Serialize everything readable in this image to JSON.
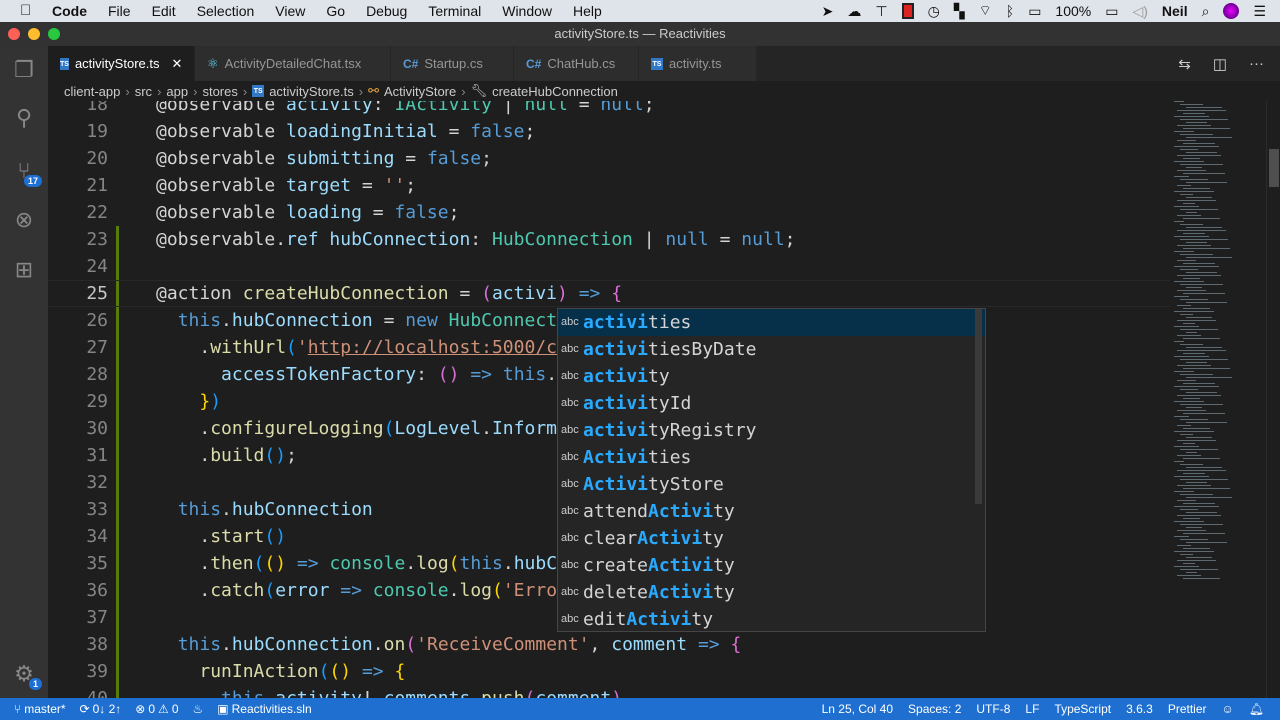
{
  "menubar": {
    "app": "Code",
    "items": [
      "File",
      "Edit",
      "Selection",
      "View",
      "Go",
      "Debug",
      "Terminal",
      "Window",
      "Help"
    ],
    "battery": "100%",
    "user": "Neil"
  },
  "window": {
    "title": "activityStore.ts — Reactivities"
  },
  "activity_bar": {
    "scm_badge": "17",
    "settings_badge": "1"
  },
  "tabs": [
    {
      "label": "activityStore.ts",
      "icon": "ts",
      "active": true
    },
    {
      "label": "ActivityDetailedChat.tsx",
      "icon": "react"
    },
    {
      "label": "Startup.cs",
      "icon": "cs"
    },
    {
      "label": "ChatHub.cs",
      "icon": "cs"
    },
    {
      "label": "activity.ts",
      "icon": "ts"
    }
  ],
  "breadcrumb": [
    "client-app",
    "src",
    "app",
    "stores",
    "activityStore.ts",
    "ActivityStore",
    "createHubConnection"
  ],
  "code_lines": [
    {
      "n": "18",
      "t": [
        [
          "@observable ",
          ""
        ],
        [
          "activity",
          "prop"
        ],
        [
          ": ",
          ""
        ],
        [
          "IActivity",
          "type"
        ],
        [
          " | ",
          ""
        ],
        [
          "null",
          "type"
        ],
        [
          " = ",
          ""
        ],
        [
          "null",
          "kw"
        ],
        [
          ";",
          ""
        ]
      ]
    },
    {
      "n": "19",
      "t": [
        [
          "@observable ",
          ""
        ],
        [
          "loadingInitial",
          "prop"
        ],
        [
          " = ",
          ""
        ],
        [
          "false",
          "kw"
        ],
        [
          ";",
          ""
        ]
      ]
    },
    {
      "n": "20",
      "t": [
        [
          "@observable ",
          ""
        ],
        [
          "submitting",
          "prop"
        ],
        [
          " = ",
          ""
        ],
        [
          "false",
          "kw"
        ],
        [
          ";",
          ""
        ]
      ]
    },
    {
      "n": "21",
      "t": [
        [
          "@observable ",
          ""
        ],
        [
          "target",
          "prop"
        ],
        [
          " = ",
          ""
        ],
        [
          "''",
          "str"
        ],
        [
          ";",
          ""
        ]
      ]
    },
    {
      "n": "22",
      "t": [
        [
          "@observable ",
          ""
        ],
        [
          "loading",
          "prop"
        ],
        [
          " = ",
          ""
        ],
        [
          "false",
          "kw"
        ],
        [
          ";",
          ""
        ]
      ]
    },
    {
      "n": "23",
      "t": [
        [
          "@observable.",
          ""
        ],
        [
          "ref ",
          "prop"
        ],
        [
          "hubConnection",
          "prop"
        ],
        [
          ": ",
          ""
        ],
        [
          "HubConnection",
          "type"
        ],
        [
          " | ",
          ""
        ],
        [
          "null",
          "kw"
        ],
        [
          " = ",
          ""
        ],
        [
          "null",
          "kw"
        ],
        [
          ";",
          ""
        ]
      ]
    },
    {
      "n": "24",
      "t": []
    },
    {
      "n": "25",
      "t": [
        [
          "@action ",
          ""
        ],
        [
          "createHubConnection",
          "fn"
        ],
        [
          " = ",
          ""
        ],
        [
          "(",
          "b2"
        ],
        [
          "activi",
          "prop"
        ],
        [
          ")",
          "b2"
        ],
        [
          " ",
          ""
        ],
        [
          "=>",
          "kw"
        ],
        [
          " ",
          ""
        ],
        [
          "{",
          "b2"
        ]
      ]
    },
    {
      "n": "26",
      "t": [
        [
          "  ",
          ""
        ],
        [
          "this",
          "kw"
        ],
        [
          ".",
          ""
        ],
        [
          "hubConnection",
          "prop"
        ],
        [
          " = ",
          ""
        ],
        [
          "new",
          "kw"
        ],
        [
          " ",
          ""
        ],
        [
          "HubConnect",
          "type"
        ]
      ]
    },
    {
      "n": "27",
      "t": [
        [
          "    .",
          ""
        ],
        [
          "withUrl",
          "fn"
        ],
        [
          "(",
          "b3"
        ],
        [
          "'",
          "str"
        ],
        [
          "http://localhost:5000/c",
          "url"
        ]
      ]
    },
    {
      "n": "28",
      "t": [
        [
          "      ",
          ""
        ],
        [
          "accessTokenFactory",
          "prop"
        ],
        [
          ": ",
          ""
        ],
        [
          "()",
          "b2"
        ],
        [
          " ",
          ""
        ],
        [
          "=>",
          "kw"
        ],
        [
          " ",
          ""
        ],
        [
          "this",
          "kw"
        ],
        [
          ".",
          ""
        ]
      ]
    },
    {
      "n": "29",
      "t": [
        [
          "    ",
          ""
        ],
        [
          "}",
          "b1"
        ],
        [
          ")",
          "b3"
        ]
      ]
    },
    {
      "n": "30",
      "t": [
        [
          "    .",
          ""
        ],
        [
          "configureLogging",
          "fn"
        ],
        [
          "(",
          "b3"
        ],
        [
          "LogLevel",
          "prop"
        ],
        [
          ".",
          ""
        ],
        [
          "Inform",
          "prop"
        ]
      ]
    },
    {
      "n": "31",
      "t": [
        [
          "    .",
          ""
        ],
        [
          "build",
          "fn"
        ],
        [
          "()",
          "b3"
        ],
        [
          ";",
          ""
        ]
      ]
    },
    {
      "n": "32",
      "t": []
    },
    {
      "n": "33",
      "t": [
        [
          "  ",
          ""
        ],
        [
          "this",
          "kw"
        ],
        [
          ".",
          ""
        ],
        [
          "hubConnection",
          "prop"
        ]
      ]
    },
    {
      "n": "34",
      "t": [
        [
          "    .",
          ""
        ],
        [
          "start",
          "fn"
        ],
        [
          "()",
          "b3"
        ]
      ]
    },
    {
      "n": "35",
      "t": [
        [
          "    .",
          ""
        ],
        [
          "then",
          "fn"
        ],
        [
          "(",
          "b3"
        ],
        [
          "()",
          "b1"
        ],
        [
          " ",
          ""
        ],
        [
          "=>",
          "kw"
        ],
        [
          " ",
          ""
        ],
        [
          "console",
          "type"
        ],
        [
          ".",
          ""
        ],
        [
          "log",
          "fn"
        ],
        [
          "(",
          "b1"
        ],
        [
          "this",
          "kw"
        ],
        [
          ".",
          ""
        ],
        [
          "hubC",
          "prop"
        ]
      ]
    },
    {
      "n": "36",
      "t": [
        [
          "    .",
          ""
        ],
        [
          "catch",
          "fn"
        ],
        [
          "(",
          "b3"
        ],
        [
          "error",
          "prop"
        ],
        [
          " ",
          ""
        ],
        [
          "=>",
          "kw"
        ],
        [
          " ",
          ""
        ],
        [
          "console",
          "type"
        ],
        [
          ".",
          ""
        ],
        [
          "log",
          "fn"
        ],
        [
          "(",
          "b1"
        ],
        [
          "'Erro",
          "str"
        ]
      ]
    },
    {
      "n": "37",
      "t": []
    },
    {
      "n": "38",
      "t": [
        [
          "  ",
          ""
        ],
        [
          "this",
          "kw"
        ],
        [
          ".",
          ""
        ],
        [
          "hubConnection",
          "prop"
        ],
        [
          ".",
          ""
        ],
        [
          "on",
          "fn"
        ],
        [
          "(",
          "b2"
        ],
        [
          "'ReceiveComment'",
          "str"
        ],
        [
          ", ",
          ""
        ],
        [
          "comment",
          "prop"
        ],
        [
          " ",
          ""
        ],
        [
          "=>",
          "kw"
        ],
        [
          " ",
          ""
        ],
        [
          "{",
          "b2"
        ]
      ]
    },
    {
      "n": "39",
      "t": [
        [
          "    ",
          ""
        ],
        [
          "runInAction",
          "fn"
        ],
        [
          "(",
          "b3"
        ],
        [
          "()",
          "b1"
        ],
        [
          " ",
          ""
        ],
        [
          "=>",
          "kw"
        ],
        [
          " ",
          ""
        ],
        [
          "{",
          "b1"
        ]
      ]
    },
    {
      "n": "40",
      "t": [
        [
          "      ",
          ""
        ],
        [
          "this",
          "kw"
        ],
        [
          ".",
          ""
        ],
        [
          "activity",
          "prop"
        ],
        [
          "!.",
          ""
        ],
        [
          "comments",
          "prop"
        ],
        [
          ".",
          ""
        ],
        [
          "push",
          "fn"
        ],
        [
          "(",
          "b2"
        ],
        [
          "comment",
          "prop"
        ],
        [
          ")",
          "b2"
        ]
      ]
    }
  ],
  "suggestions": [
    {
      "kind": "abc",
      "match": "activi",
      "rest": "ties",
      "selected": true
    },
    {
      "kind": "abc",
      "match": "activi",
      "rest": "tiesByDate"
    },
    {
      "kind": "abc",
      "match": "activi",
      "rest": "ty"
    },
    {
      "kind": "abc",
      "match": "activi",
      "rest": "tyId"
    },
    {
      "kind": "abc",
      "match": "activi",
      "rest": "tyRegistry"
    },
    {
      "kind": "abc",
      "match": "Activi",
      "rest": "ties"
    },
    {
      "kind": "abc",
      "match": "Activi",
      "rest": "tyStore"
    },
    {
      "kind": "abc",
      "pre": "attend",
      "match": "Activi",
      "rest": "ty"
    },
    {
      "kind": "abc",
      "pre": "clear",
      "match": "Activi",
      "rest": "ty"
    },
    {
      "kind": "abc",
      "pre": "create",
      "match": "Activi",
      "rest": "ty"
    },
    {
      "kind": "abc",
      "pre": "delete",
      "match": "Activi",
      "rest": "ty"
    },
    {
      "kind": "abc",
      "pre": "edit",
      "match": "Activi",
      "rest": "ty"
    }
  ],
  "status": {
    "branch": "master*",
    "sync": "0↓ 2↑",
    "errors": "0",
    "warnings": "0",
    "solution": "Reactivities.sln",
    "position": "Ln 25, Col 40",
    "spaces": "Spaces: 2",
    "encoding": "UTF-8",
    "eol": "LF",
    "language": "TypeScript",
    "version": "3.6.3",
    "formatter": "Prettier"
  },
  "colors": {
    "accent": "#1f6fd0",
    "editor_bg": "#1e1e1e",
    "match": "#2aaaff"
  }
}
